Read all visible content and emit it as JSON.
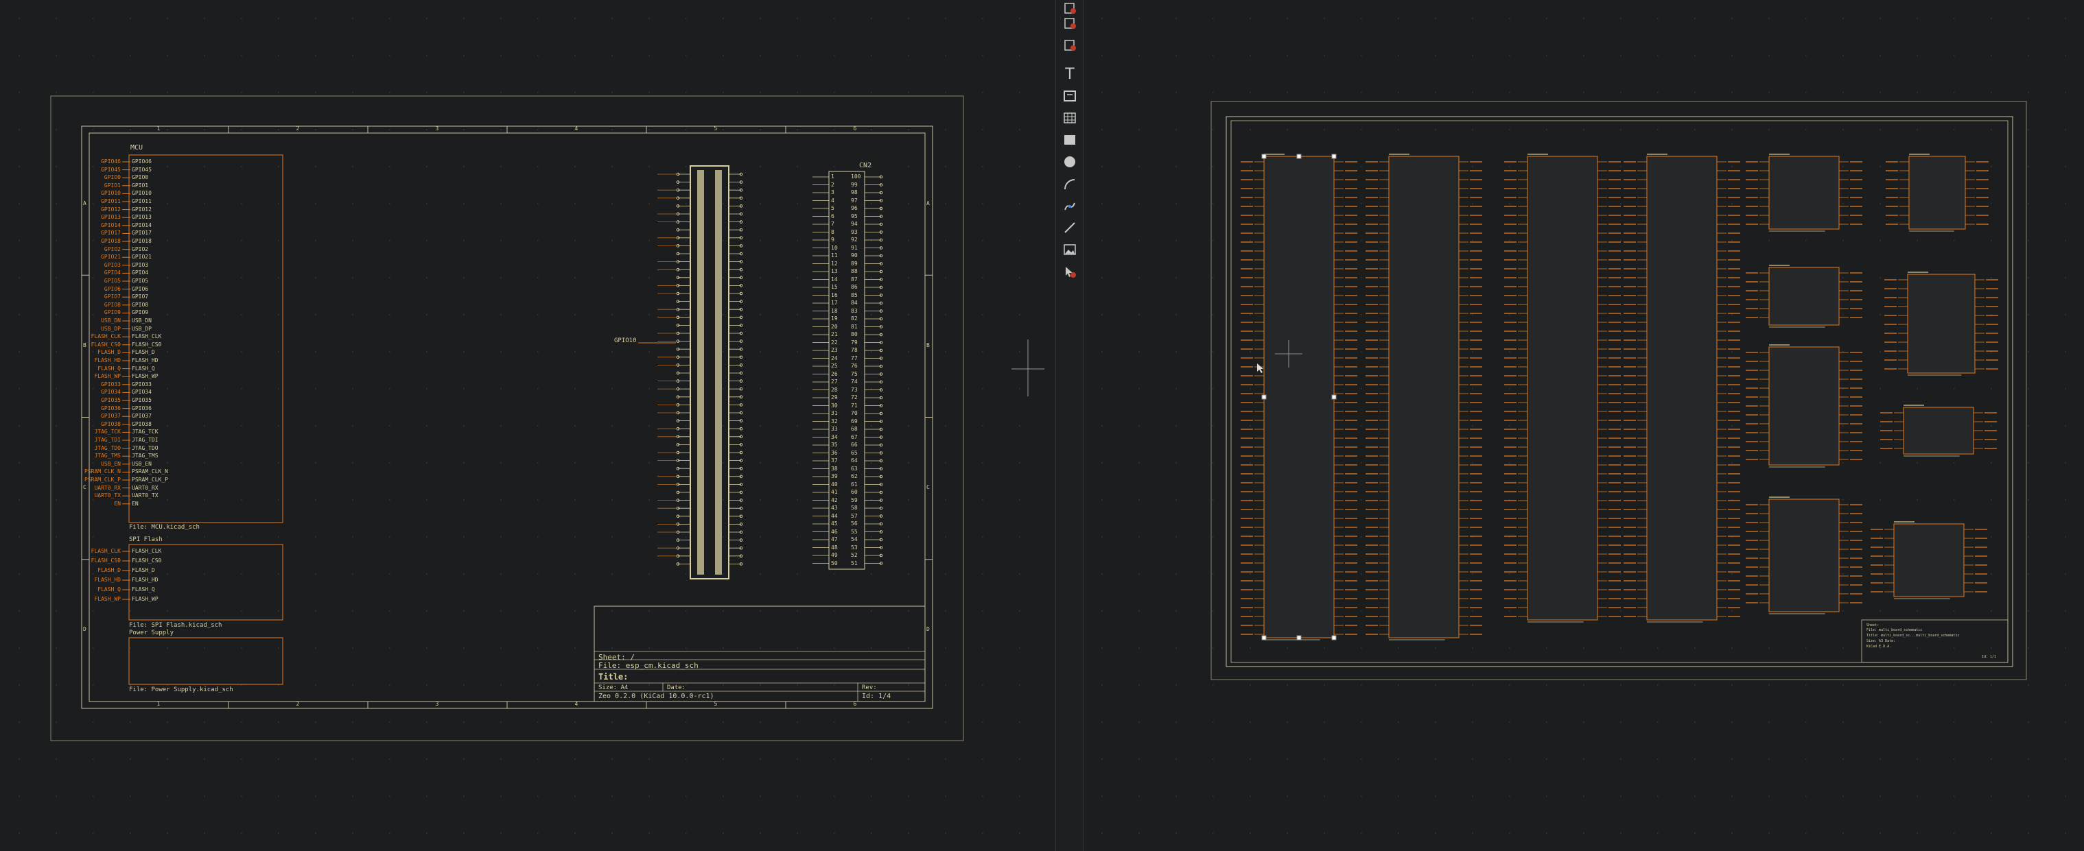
{
  "colors": {
    "background": "#1b1d1f",
    "sheet_frame": "#c9c1a0",
    "wire": "#e07a1f",
    "label": "#d8cfa0",
    "sheet_border": "#c86b1a",
    "accent": "#e8e0b0"
  },
  "left": {
    "grid_cols": [
      "1",
      "2",
      "3",
      "4",
      "5",
      "6"
    ],
    "grid_rows": [
      "A",
      "B",
      "C",
      "D"
    ],
    "mcu": {
      "title": "MCU",
      "file": "File: MCU.kicad_sch",
      "pins": [
        "GPIO46",
        "GPIO45",
        "GPIO0",
        "GPIO1",
        "GPIO10",
        "GPIO11",
        "GPIO12",
        "GPIO13",
        "GPIO14",
        "GPIO17",
        "GPIO18",
        "GPIO2",
        "GPIO21",
        "GPIO3",
        "GPIO4",
        "GPIO5",
        "GPIO6",
        "GPIO7",
        "GPIO8",
        "GPIO9",
        "USB_DN",
        "USB_DP",
        "FLASH_CLK",
        "FLASH_CS0",
        "FLASH_D",
        "FLASH_HD",
        "FLASH_Q",
        "FLASH_WP",
        "GPIO33",
        "GPIO34",
        "GPIO35",
        "GPIO36",
        "GPIO37",
        "GPIO38",
        "JTAG_TCK",
        "JTAG_TDI",
        "JTAG_TDO",
        "JTAG_TMS",
        "USB_EN",
        "PSRAM_CLK_N",
        "PSRAM_CLK_P",
        "UART0_RX",
        "UART0_TX",
        "EN"
      ]
    },
    "spi_flash": {
      "title": "SPI Flash",
      "file": "File: SPI Flash.kicad_sch",
      "pins": [
        "FLASH_CLK",
        "FLASH_CS0",
        "FLASH_D",
        "FLASH_HD",
        "FLASH_Q",
        "FLASH_WP"
      ]
    },
    "power": {
      "title": "Power Supply",
      "file": "File: Power Supply.kicad_sch"
    },
    "connector_label": "GPIO10",
    "cn2": {
      "ref": "CN2",
      "left_nums": [
        "1",
        "2",
        "3",
        "4",
        "5",
        "6",
        "7",
        "8",
        "9",
        "10",
        "11",
        "12",
        "13",
        "14",
        "15",
        "16",
        "17",
        "18",
        "19",
        "20",
        "21",
        "22",
        "23",
        "24",
        "25",
        "26",
        "27",
        "28",
        "29",
        "30",
        "31",
        "32",
        "33",
        "34",
        "35",
        "36",
        "37",
        "38",
        "39",
        "40",
        "41",
        "42",
        "43",
        "44",
        "45",
        "46",
        "47",
        "48",
        "49",
        "50"
      ],
      "right_nums": [
        "100",
        "99",
        "98",
        "97",
        "96",
        "95",
        "94",
        "93",
        "92",
        "91",
        "90",
        "89",
        "88",
        "87",
        "86",
        "85",
        "84",
        "83",
        "82",
        "81",
        "80",
        "79",
        "78",
        "77",
        "76",
        "75",
        "74",
        "73",
        "72",
        "71",
        "70",
        "69",
        "68",
        "67",
        "66",
        "65",
        "64",
        "63",
        "62",
        "61",
        "60",
        "59",
        "58",
        "57",
        "56",
        "55",
        "54",
        "53",
        "52",
        "51"
      ]
    },
    "title_block": {
      "sheet": "Sheet: /",
      "file": "File: esp_cm.kicad_sch",
      "title": "Title:",
      "size": "Size: A4",
      "date": "Date:",
      "rev": "Rev:",
      "kicad": "Zeo 0.2.0 (KiCad 10.0.0-rc1)",
      "id": "Id: 1/4"
    }
  },
  "right": {
    "title_block": {
      "line1": "Sheet:",
      "line2": "File: multi_board_schematic",
      "line3": "Title: multi_board_sc...multi_board_schematic",
      "line4": "Size: A3   Date:",
      "line5": "KiCad E.D.A.",
      "id": "Id: 1/1"
    }
  },
  "toolbar": {
    "tools": [
      "sim-icon",
      "pin-icon",
      "sheet-pin-icon",
      "text-icon",
      "textbox-icon",
      "table-icon",
      "rectangle-icon",
      "circle-icon",
      "arc-icon",
      "bezier-icon",
      "line-icon",
      "image-icon",
      "delete-icon"
    ],
    "text_glyph": "T"
  }
}
